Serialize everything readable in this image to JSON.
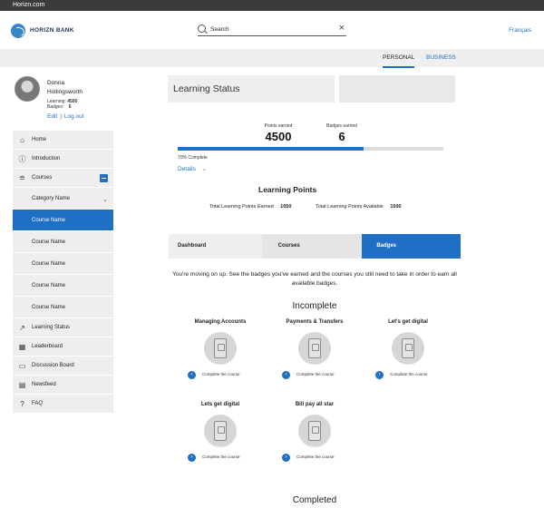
{
  "browser": {
    "url": "Horizn.com"
  },
  "header": {
    "logo_text": "HORIZN BANK",
    "search_placeholder": "Search",
    "language_link": "Français"
  },
  "segments": {
    "personal": "PERSONAL",
    "business": "BUSINESS"
  },
  "profile": {
    "first_name": "Donna",
    "last_name": "Hollingsworth",
    "learning_label": "Learning:",
    "learning_value": "4500",
    "badges_label": "Badges:",
    "badges_value": "6",
    "edit_link": "Edit",
    "logout_link": "Log out"
  },
  "nav": {
    "home": "Home",
    "introduction": "Introduction",
    "courses": "Courses",
    "category": "Category Name",
    "course_items": [
      "Course Name",
      "Course Name",
      "Course Name",
      "Course Name",
      "Course Name"
    ],
    "learning_status": "Learning Status",
    "leaderboard": "Leaderboard",
    "discussion_board": "Discussion Board",
    "newsfeed": "Newsfeed",
    "faq": "FAQ"
  },
  "learning_status": {
    "title": "Learning Status",
    "points_label": "Points earned",
    "points_value": "4500",
    "badges_label": "Badges earned",
    "badges_value": "6",
    "progress_percent": 70,
    "progress_text": "70% Complete",
    "details_link": "Details"
  },
  "learning_points": {
    "title": "Learning Points",
    "earned_label": "Total Learning Points Earned",
    "earned_value": "1050",
    "available_label": "Total Learning Points Available",
    "available_value": "1500"
  },
  "tabs": {
    "dashboard": "Dashboard",
    "courses": "Courses",
    "badges": "Badges"
  },
  "badges_intro": "You're moving on up. See the badges you've earned and the courses you still need to take in order to earn all available badges.",
  "incomplete_title": "Incomplete",
  "completed_title": "Completed",
  "badges": [
    {
      "title": "Managing Accounts",
      "cta": "Complete the course"
    },
    {
      "title": "Payments & Transfers",
      "cta": "Complete the course"
    },
    {
      "title": "Let's get digital",
      "cta": "Complete the course"
    },
    {
      "title": "Lets get digital",
      "cta": "Complete the course"
    },
    {
      "title": "Bill pay all star",
      "cta": "Complete the course"
    }
  ],
  "colors": {
    "accent": "#1f6fc4",
    "topbar": "#3b3b3b",
    "panel": "#efefef"
  }
}
